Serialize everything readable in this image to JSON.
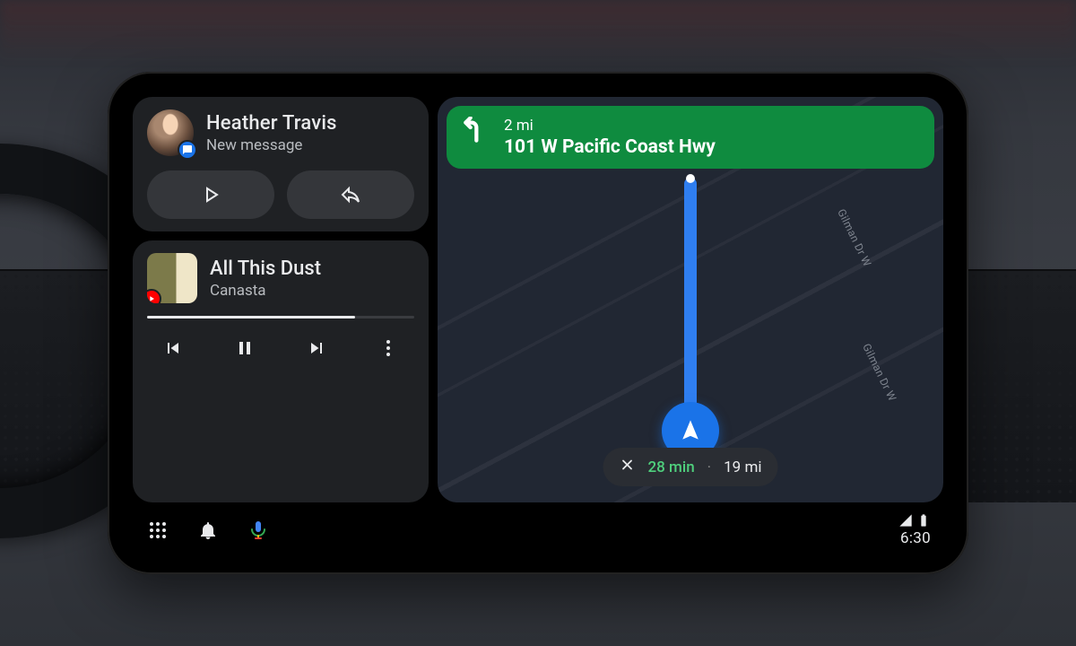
{
  "message": {
    "sender": "Heather Travis",
    "subtitle": "New message"
  },
  "media": {
    "title": "All This Dust",
    "artist": "Canasta",
    "progress_pct": 78
  },
  "nav": {
    "distance": "2 mi",
    "street": "101 W Pacific Coast Hwy",
    "road_label_a": "Gilman Dr W",
    "road_label_b": "Gilman Dr W",
    "eta_time": "28 min",
    "eta_sep": "·",
    "eta_dist": "19 mi"
  },
  "status": {
    "clock": "6:30"
  }
}
